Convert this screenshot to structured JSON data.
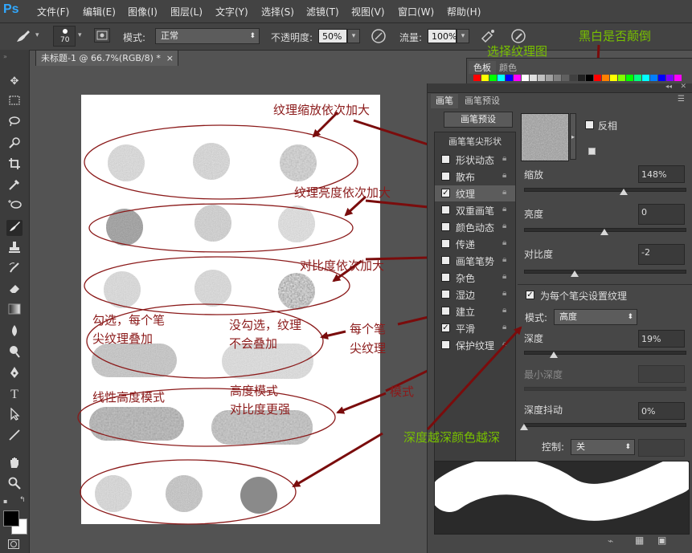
{
  "app": {
    "logo": "Ps"
  },
  "menu": [
    "文件(F)",
    "编辑(E)",
    "图像(I)",
    "图层(L)",
    "文字(Y)",
    "选择(S)",
    "滤镜(T)",
    "视图(V)",
    "窗口(W)",
    "帮助(H)"
  ],
  "options": {
    "brush_size": "70",
    "mode_label": "模式:",
    "mode_value": "正常",
    "opacity_label": "不透明度:",
    "opacity_value": "50%",
    "flow_label": "流量:",
    "flow_value": "100%"
  },
  "document": {
    "tab_title": "未标题-1 @ 66.7%(RGB/8) *",
    "close": "×"
  },
  "swatches": {
    "tabs": [
      "色板",
      "颜色"
    ],
    "colors": [
      "#ff0000",
      "#ffff00",
      "#00ff00",
      "#00ffff",
      "#0000ff",
      "#ff00ff",
      "#ffffff",
      "#e0e0e0",
      "#c0c0c0",
      "#a0a0a0",
      "#808080",
      "#606060",
      "#404040",
      "#202020",
      "#000000",
      "#ff0000",
      "#ff8000",
      "#ffff00",
      "#80ff00",
      "#00ff00",
      "#00ff80",
      "#00ffff",
      "#0080ff",
      "#0000ff",
      "#8000ff",
      "#ff00ff"
    ]
  },
  "brush_panel": {
    "tabs": [
      "画笔",
      "画笔预设"
    ],
    "preset_button": "画笔预设",
    "options": [
      {
        "label": "画笔笔尖形状",
        "checked": false,
        "header": true
      },
      {
        "label": "形状动态",
        "checked": false
      },
      {
        "label": "散布",
        "checked": false
      },
      {
        "label": "纹理",
        "checked": true,
        "selected": true
      },
      {
        "label": "双重画笔",
        "checked": false
      },
      {
        "label": "颜色动态",
        "checked": false
      },
      {
        "label": "传递",
        "checked": false
      },
      {
        "label": "画笔笔势",
        "checked": false
      },
      {
        "label": "杂色",
        "checked": false
      },
      {
        "label": "湿边",
        "checked": false
      },
      {
        "label": "建立",
        "checked": false
      },
      {
        "label": "平滑",
        "checked": true
      },
      {
        "label": "保护纹理",
        "checked": false
      }
    ],
    "invert_label": "反相",
    "scale_label": "缩放",
    "scale_value": "148%",
    "brightness_label": "亮度",
    "brightness_value": "0",
    "contrast_label": "对比度",
    "contrast_value": "-2",
    "texture_each_tip": "为每个笔尖设置纹理",
    "mode_label": "模式:",
    "mode_value": "高度",
    "depth_label": "深度",
    "depth_value": "19%",
    "min_depth_label": "最小深度",
    "depth_jitter_label": "深度抖动",
    "depth_jitter_value": "0%",
    "control_label": "控制:",
    "control_value": "关"
  },
  "annotations": {
    "scale": "纹理缩放依次加大",
    "brightness": "纹理亮度依次加大",
    "contrast": "对比度依次加大",
    "checked_line1": "勾选，每个笔",
    "checked_line2": "尖纹理叠加",
    "unchecked_line1": "没勾选，纹理",
    "unchecked_line2": "不会叠加",
    "each_tip_line1": "每个笔",
    "each_tip_line2": "尖纹理",
    "linear_height": "线性高度模式",
    "height_line1": "高度模式",
    "height_line2": "对比度更强",
    "mode": "模式",
    "select_texture": "选择纹理图",
    "invert_note": "黑白是否颠倒",
    "depth_note": "深度越深颜色越深"
  }
}
